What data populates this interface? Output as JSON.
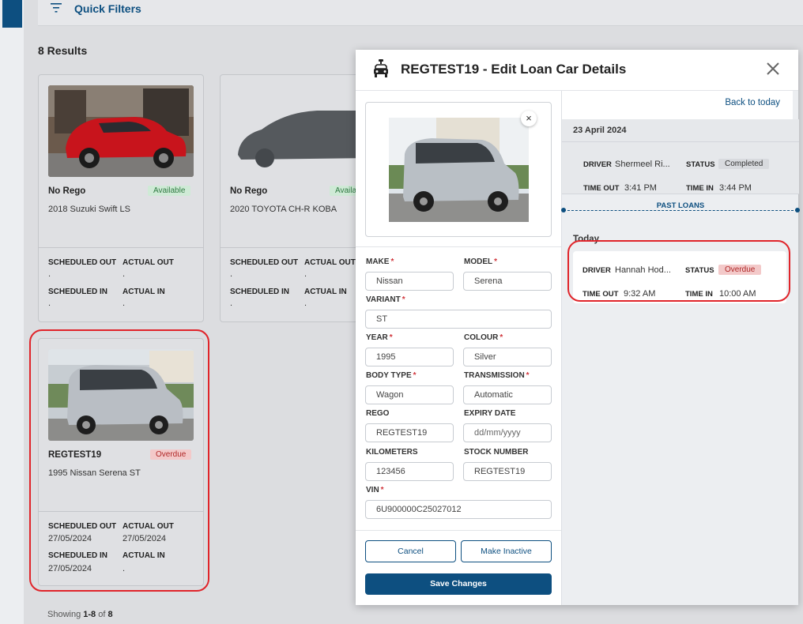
{
  "quick_filters": {
    "label": "Quick Filters"
  },
  "results": {
    "label": "8 Results"
  },
  "cards": [
    {
      "rego": "No Rego",
      "status": "Available",
      "model": "2018 Suzuki Swift LS",
      "scheduled_out_label": "SCHEDULED OUT",
      "actual_out_label": "ACTUAL OUT",
      "scheduled_in_label": "SCHEDULED IN",
      "actual_in_label": "ACTUAL IN",
      "scheduled_out": ".",
      "actual_out": ".",
      "scheduled_in": ".",
      "actual_in": "."
    },
    {
      "rego": "No Rego",
      "status": "Availa",
      "model": "2020 TOYOTA CH-R KOBA",
      "scheduled_out_label": "SCHEDULED OUT",
      "actual_out_label": "ACTUAL OUT",
      "scheduled_in_label": "SCHEDULED IN",
      "actual_in_label": "ACTUAL IN",
      "scheduled_out": ".",
      "actual_out": ".",
      "scheduled_in": ".",
      "actual_in": "."
    },
    {
      "rego": "REGTEST19",
      "status": "Overdue",
      "model": "1995 Nissan Serena ST",
      "scheduled_out_label": "SCHEDULED OUT",
      "actual_out_label": "ACTUAL OUT",
      "scheduled_in_label": "SCHEDULED IN",
      "actual_in_label": "ACTUAL IN",
      "scheduled_out": "27/05/2024",
      "actual_out": "27/05/2024",
      "scheduled_in": "27/05/2024",
      "actual_in": "."
    }
  ],
  "showing": {
    "prefix": "Showing ",
    "range": "1-8",
    "of": " of ",
    "total": "8"
  },
  "modal": {
    "title": "REGTEST19 - Edit Loan Car Details",
    "remove_image": "×",
    "fields": {
      "make": {
        "label": "MAKE",
        "value": "Nissan"
      },
      "model": {
        "label": "MODEL",
        "value": "Serena"
      },
      "variant": {
        "label": "VARIANT",
        "value": "ST"
      },
      "year": {
        "label": "YEAR",
        "value": "1995"
      },
      "colour": {
        "label": "COLOUR",
        "value": "Silver"
      },
      "body_type": {
        "label": "BODY TYPE",
        "value": "Wagon"
      },
      "transmission": {
        "label": "TRANSMISSION",
        "value": "Automatic"
      },
      "rego": {
        "label": "REGO",
        "value": "REGTEST19"
      },
      "expiry_date": {
        "label": "EXPIRY DATE",
        "value": "",
        "placeholder": "dd/mm/yyyy"
      },
      "kilometers": {
        "label": "KILOMETERS",
        "value": "123456"
      },
      "stock_number": {
        "label": "STOCK NUMBER",
        "value": "REGTEST19"
      },
      "vin": {
        "label": "VIN",
        "value": "6U900000C25027012"
      }
    },
    "buttons": {
      "cancel": "Cancel",
      "make_inactive": "Make Inactive",
      "save": "Save Changes"
    },
    "history": {
      "back_to_today": "Back to today",
      "past_date": "23 April 2024",
      "past_loan": {
        "driver_label": "DRIVER",
        "driver": "Shermeel Ri...",
        "status_label": "STATUS",
        "status": "Completed",
        "time_out_label": "TIME OUT",
        "time_out": "3:41 PM",
        "time_in_label": "TIME IN",
        "time_in": "3:44 PM"
      },
      "past_loans_label": "PAST LOANS",
      "today_label": "Today",
      "today_loan": {
        "driver_label": "DRIVER",
        "driver": "Hannah Hod...",
        "status_label": "STATUS",
        "status": "Overdue",
        "time_out_label": "TIME OUT",
        "time_out": "9:32 AM",
        "time_in_label": "TIME IN",
        "time_in": "10:00 AM"
      }
    }
  },
  "colors": {
    "primary": "#0d4f80",
    "overdue": "#b02828",
    "available": "#2f7a42",
    "highlight": "#e0242a"
  }
}
